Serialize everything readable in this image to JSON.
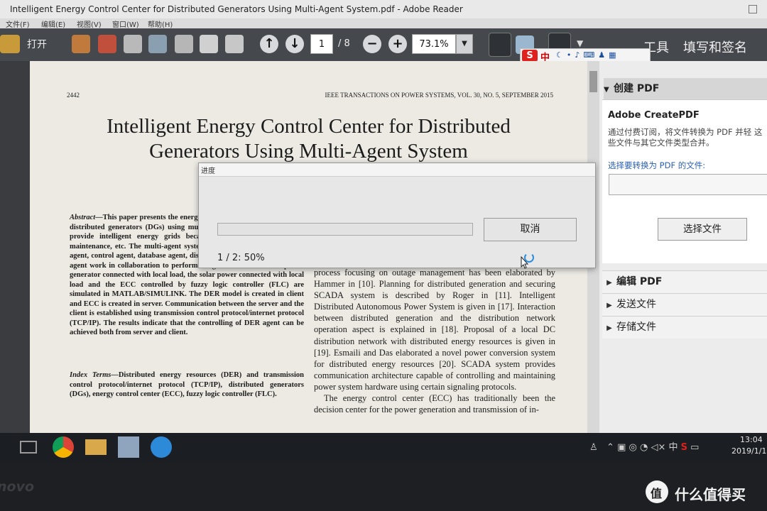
{
  "window": {
    "title": "Intelligent Energy Control Center for Distributed Generators Using Multi-Agent System.pdf - Adobe Reader"
  },
  "menu": [
    "文件(F)",
    "编辑(E)",
    "视图(V)",
    "窗口(W)",
    "帮助(H)"
  ],
  "toolbar": {
    "open_label": "打开",
    "page_current": "1",
    "page_total": "/ 8",
    "zoom": "73.1%",
    "tools_label": "工具",
    "fill_sign_label": "填写和签名",
    "ime_s": "S",
    "ime_lang": "中"
  },
  "document": {
    "page_number": "2442",
    "journal": "IEEE TRANSACTIONS ON POWER SYSTEMS, VOL. 30, NO. 5, SEPTEMBER 2015",
    "title_line1": "Intelligent Energy Control Center for Distributed",
    "title_line2": "Generators Using Multi-Agent System",
    "abstract_label": "Abstract",
    "abstract_text": "—This paper presents the energy control center (ECC) control of distributed generators (DGs) using multi-agent system. M proposed to provide intelligent energy grids because of their benefits of exte maintenance, etc. The multi-agent system grid and agents such as user agent, control agent, database agent, distributed energy resources (DER) agent work in collaboration to perform assigned tasks. The wind power generator connected with local load, the solar power connected with local load and the ECC controlled by fuzzy logic controller (FLC) are simulated in MATLAB/SIMULINK. The DER model is created in client and ECC is created in server. Communication between the server and the client is established using transmission control protocol/internet protocol (TCP/IP). The results indicate that the controlling of DER agent can be achieved both from server and client.",
    "index_label": "Index Terms",
    "index_text": "—Distributed energy resources (DER) and transmission control protocol/internet protocol (TCP/IP), distributed generators (DGs), energy control center (ECC), fuzzy logic controller (FLC).",
    "right_col_p1": "process focusing on outage management has been elaborated by Hammer in [10]. Planning for distributed generation and securing SCADA system is described by Roger in [11]. Intelligent Distributed Autonomous Power System is given in [17]. Interaction between distributed generation and the distribution network operation aspect is explained in [18]. Proposal of a local DC distribution network with distributed energy resources is given in [19]. Esmaili and Das elaborated a novel power conversion system for distributed energy resources [20]. SCADA system provides communication architecture capable of controlling and maintaining power system hardware using certain signaling protocols.",
    "right_col_p2": "The energy control center (ECC) has traditionally been the decision center for the power generation and transmission of in-"
  },
  "right_panel": {
    "create_pdf": "创建 PDF",
    "acp_title": "Adobe CreatePDF",
    "acp_desc": "通过付费订阅，将文件转换为 PDF 并轻 这些文件与其它文件类型合并。",
    "acp_pick": "选择要转换为 PDF 的文件:",
    "acp_button": "选择文件",
    "edit_pdf": "编辑 PDF",
    "send_files": "发送文件",
    "store_files": "存储文件"
  },
  "dialog": {
    "title": "进度",
    "cancel": "取消",
    "status": "1 / 2:  50%",
    "progress": 0.0
  },
  "taskbar": {
    "time": "13:04",
    "date": "2019/1/1",
    "ime": "中"
  },
  "bezel": {
    "brand": "novo",
    "watermark": "什么值得买",
    "wm_icon": "值"
  },
  "colors": {
    "toolbar_bg": "#45484c",
    "doc_bg": "#eceae3",
    "link_blue": "#2b5fb4",
    "brand_red": "#e0201c"
  }
}
